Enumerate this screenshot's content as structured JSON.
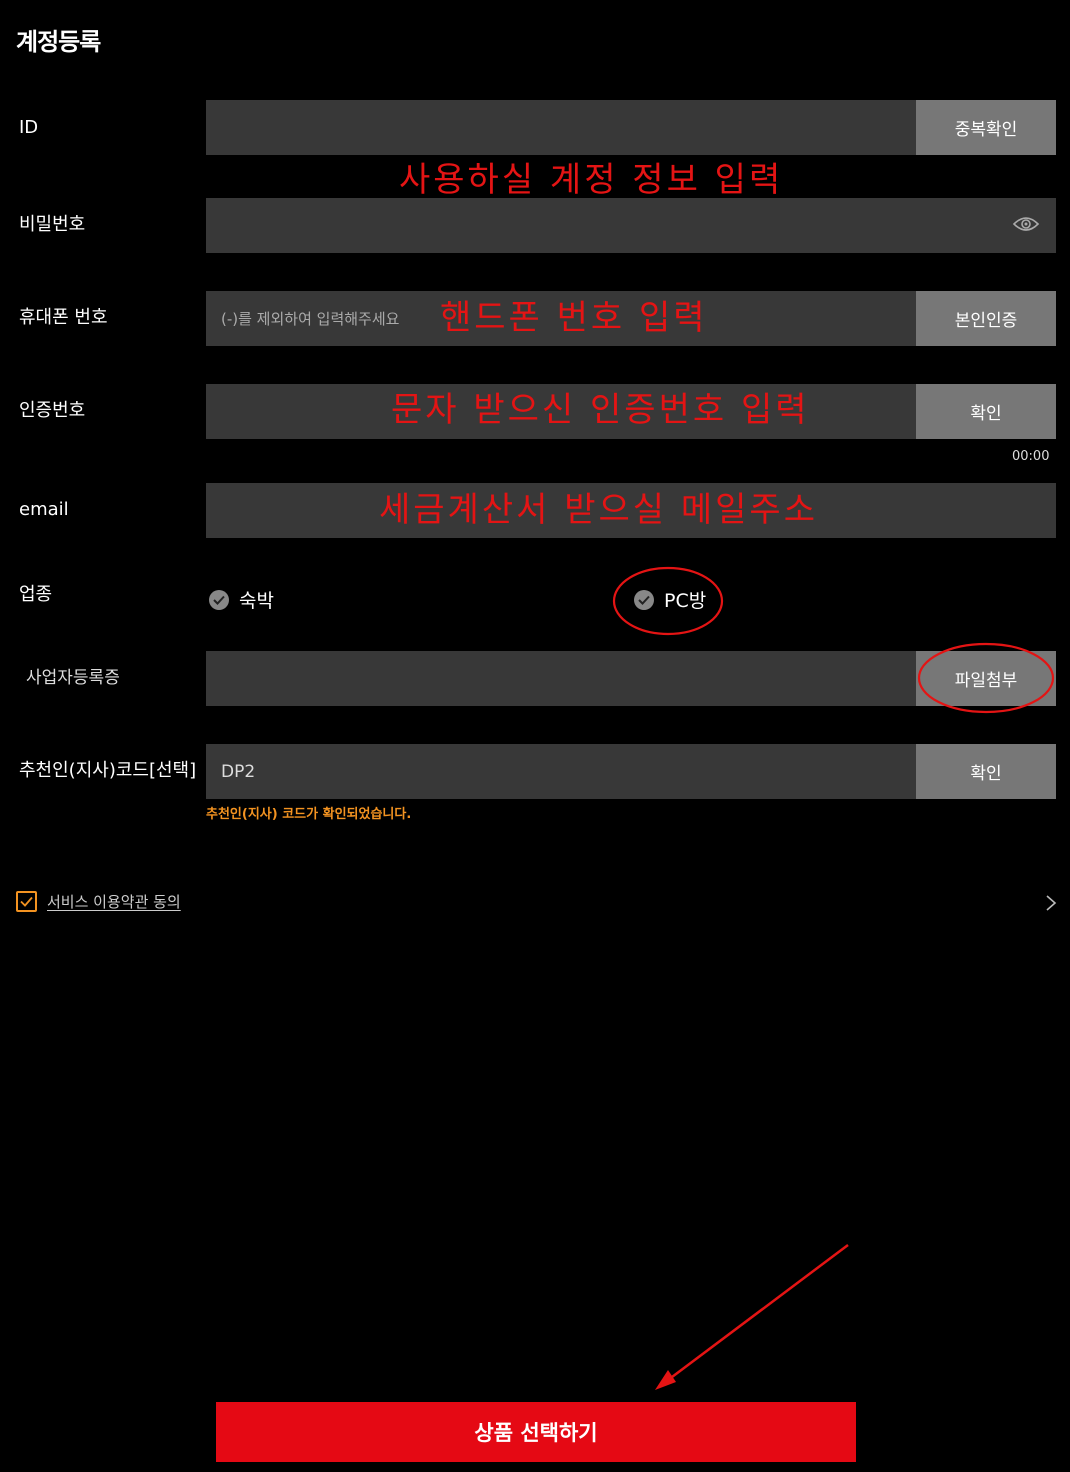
{
  "header": {
    "title": "계정등록"
  },
  "form": {
    "id": {
      "label": "ID",
      "value": "",
      "button": "중복확인"
    },
    "password": {
      "label": "비밀번호",
      "value": ""
    },
    "phone": {
      "label": "휴대폰 번호",
      "placeholder": "(-)를 제외하여 입력해주세요",
      "button": "본인인증"
    },
    "auth_code": {
      "label": "인증번호",
      "value": "",
      "button": "확인",
      "timer": "00:00"
    },
    "email": {
      "label": "email",
      "value": ""
    },
    "business_type": {
      "label": "업종",
      "options": [
        "숙박",
        "PC방"
      ]
    },
    "business_license": {
      "label": "사업자등록증",
      "button": "파일첨부"
    },
    "referral": {
      "label": "추천인(지사)코드[선택]",
      "value": "DP2",
      "button": "확인",
      "notice": "추천인(지사) 코드가 확인되었습니다."
    }
  },
  "agreement": {
    "label": "서비스 이용약관 동의",
    "checked": true
  },
  "submit": {
    "label": "상품 선택하기"
  },
  "annotations": {
    "account": "사용하실 계정 정보 입력",
    "phone": "핸드폰 번호 입력",
    "auth": "문자 받으신 인증번호 입력",
    "email": "세금계산서 받으실 메일주소"
  },
  "colors": {
    "background": "#000000",
    "field": "#383838",
    "button": "#777777",
    "accent": "#e50914",
    "notice": "#f39321",
    "annotation": "#e41414"
  }
}
